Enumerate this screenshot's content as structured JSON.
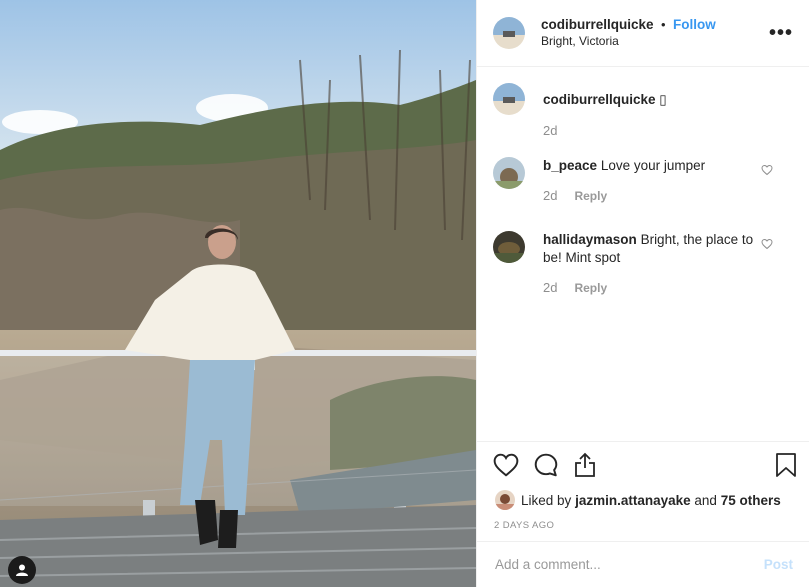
{
  "post": {
    "username": "codiburrellquicke",
    "follow_label": "Follow",
    "location": "Bright, Victoria",
    "caption_emoji": "▯"
  },
  "comments": [
    {
      "username": "codiburrellquicke",
      "text": "",
      "age": "2d",
      "reply": ""
    },
    {
      "username": "b_peace",
      "text": "Love your jumper",
      "age": "2d",
      "reply": "Reply"
    },
    {
      "username": "hallidaymason",
      "text": "Bright, the place to be! Mint spot",
      "age": "2d",
      "reply": "Reply"
    }
  ],
  "likes": {
    "prefix": "Liked by",
    "user": "jazmin.attanayake",
    "joiner": "and",
    "others": "75 others"
  },
  "timestamp": "2 DAYS AGO",
  "composer": {
    "placeholder": "Add a comment...",
    "post_label": "Post"
  },
  "colors": {
    "follow": "#3897f0",
    "muted": "#8e8e8e",
    "post_disabled": "#c5e1fb"
  }
}
